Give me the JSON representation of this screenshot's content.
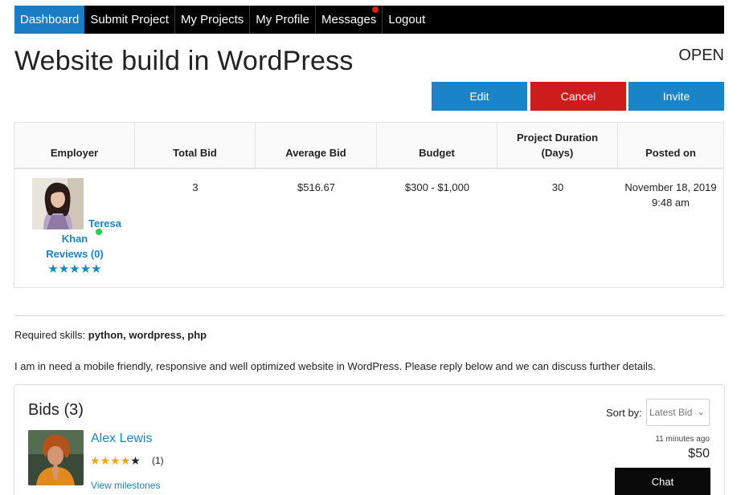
{
  "nav": {
    "items": [
      "Dashboard",
      "Submit Project",
      "My Projects",
      "My Profile",
      "Messages",
      "Logout"
    ]
  },
  "project": {
    "title": "Website build in WordPress",
    "status": "OPEN"
  },
  "actions": {
    "edit_label": "Edit",
    "cancel_label": "Cancel",
    "invite_label": "Invite"
  },
  "table": {
    "headers": [
      "Employer",
      "Total Bid",
      "Average Bid",
      "Budget",
      "Project Duration (Days)",
      "Posted on"
    ],
    "row": {
      "employer_first": "Teresa",
      "employer_last": "Khan",
      "reviews": "Reviews (0)",
      "stars": "★★★★★",
      "total_bid": "3",
      "average_bid": "$516.67",
      "budget": "$300 - $1,000",
      "duration": "30",
      "posted_date": "November 18, 2019",
      "posted_time": "9:48 am"
    }
  },
  "skills": {
    "label": "Required skills:",
    "values": "python, wordpress, php"
  },
  "description": "I am in need a mobile friendly, responsive and well optimized website in WordPress. Please reply below and we can discuss further details.",
  "bids": {
    "title": "Bids (3)",
    "sort_label": "Sort by:",
    "sort_value": "Latest Bid",
    "items": [
      {
        "name": "Alex Lewis",
        "rating_count": "(1)",
        "rating": 4,
        "view_milestones": "View milestones",
        "time": "11 minutes ago",
        "amount": "$50",
        "chat_label": "Chat"
      }
    ]
  },
  "colors": {
    "accent": "#1a84c9",
    "danger": "#cc1c1c",
    "nav_bg": "#000000",
    "star": "#f4a21a",
    "online": "#22d04a"
  }
}
